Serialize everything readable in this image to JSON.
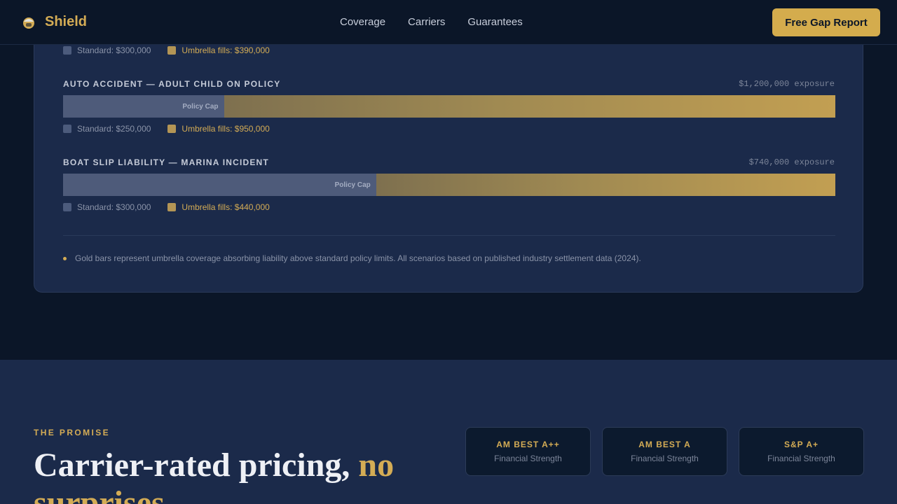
{
  "nav": {
    "brand": "Shield",
    "links": [
      "Coverage",
      "Carriers",
      "Guarantees"
    ],
    "cta": "Free Gap Report"
  },
  "scenarios": [
    {
      "title": "",
      "exposure": "",
      "standard_legend": "Standard: $300,000",
      "umbrella_legend": "Umbrella fills: $390,000"
    },
    {
      "title": "AUTO ACCIDENT — ADULT CHILD ON POLICY",
      "exposure": "$1,200,000 exposure",
      "cap_label": "Policy Cap",
      "standard_fraction": 0.2083,
      "standard_legend": "Standard: $250,000",
      "umbrella_legend": "Umbrella fills: $950,000"
    },
    {
      "title": "BOAT SLIP LIABILITY — MARINA INCIDENT",
      "exposure": "$740,000 exposure",
      "cap_label": "Policy Cap",
      "standard_fraction": 0.4054,
      "standard_legend": "Standard: $300,000",
      "umbrella_legend": "Umbrella fills: $440,000"
    }
  ],
  "footnote": "Gold bars represent umbrella coverage absorbing liability above standard policy limits. All scenarios based on published industry settlement data (2024).",
  "promise": {
    "eyebrow": "THE PROMISE",
    "headline_main": "Carrier-rated pricing, ",
    "headline_accent": "no surprises",
    "ratings": [
      {
        "name": "AM BEST A++",
        "sub": "Financial Strength"
      },
      {
        "name": "AM BEST A",
        "sub": "Financial Strength"
      },
      {
        "name": "S&P A+",
        "sub": "Financial Strength"
      }
    ]
  },
  "colors": {
    "accent": "#d4ac55",
    "background": "#0b1628",
    "card": "#1b2a4a",
    "standard": "#4e5b7a"
  },
  "icons": {
    "brand": "shield-helmet-icon"
  }
}
